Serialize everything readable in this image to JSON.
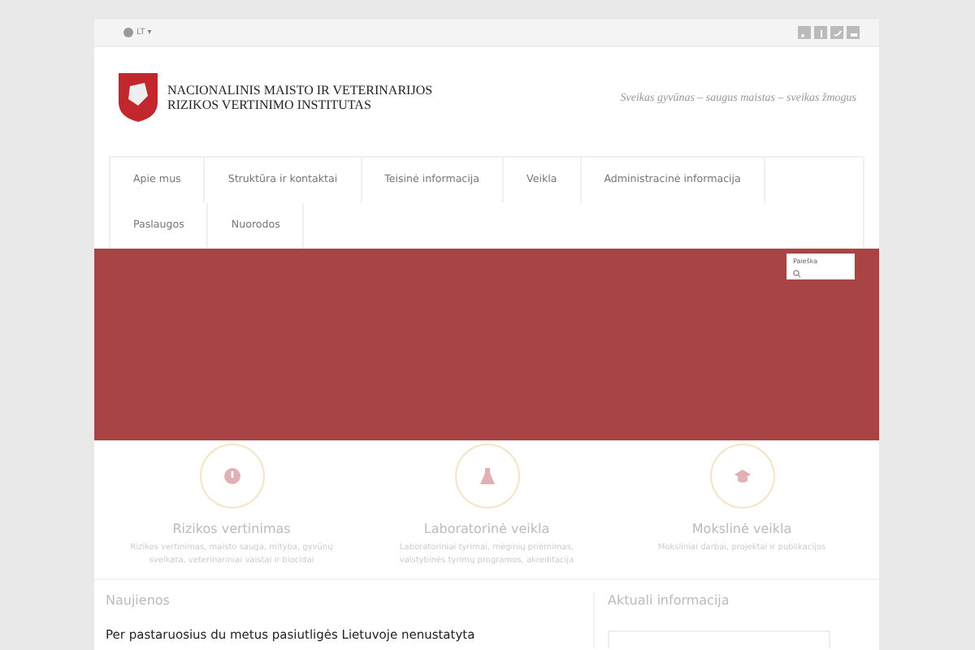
{
  "topbar": {
    "language": "LT",
    "caret": "▾",
    "social": [
      {
        "kind": "rss"
      },
      {
        "kind": "facebook"
      },
      {
        "kind": "twitter"
      },
      {
        "kind": "share"
      }
    ]
  },
  "header": {
    "title_line1": "NACIONALINIS MAISTO IR VETERINARIJOS",
    "title_line2": "RIZIKOS VERTINIMO INSTITUTAS",
    "slogan": "Sveikas gyvūnas – saugus maistas – sveikas žmogus"
  },
  "nav": {
    "items": [
      {
        "label": "Apie mus"
      },
      {
        "label": "Struktūra ir kontaktai"
      },
      {
        "label": "Teisinė informacija"
      },
      {
        "label": "Veikla"
      },
      {
        "label": "Administracinė informacija"
      },
      {
        "label": "Paslaugos"
      },
      {
        "label": "Nuorodos"
      }
    ]
  },
  "search": {
    "placeholder": "Paieška"
  },
  "features": [
    {
      "kind": "alert",
      "title": "Rizikos vertinimas",
      "text": "Rizikos vertinimas, maisto sauga, mityba, gyvūnų sveikata, veterinariniai vaistai ir biocidai"
    },
    {
      "kind": "flask",
      "title": "Laboratorinė veikla",
      "text": "Laboratoriniai tyrimai, mėginių priėmimas, valstybinės tyrimų programos, akreditacija"
    },
    {
      "kind": "cap",
      "title": "Mokslinė veikla",
      "text": "Moksliniai darbai, projektai ir publikacijos"
    }
  ],
  "news": {
    "heading": "Naujienos",
    "headline": "Per pastaruosius du metus pasiutligės Lietuvoje nenustatyta"
  },
  "sidebar": {
    "heading": "Aktuali informacija"
  }
}
